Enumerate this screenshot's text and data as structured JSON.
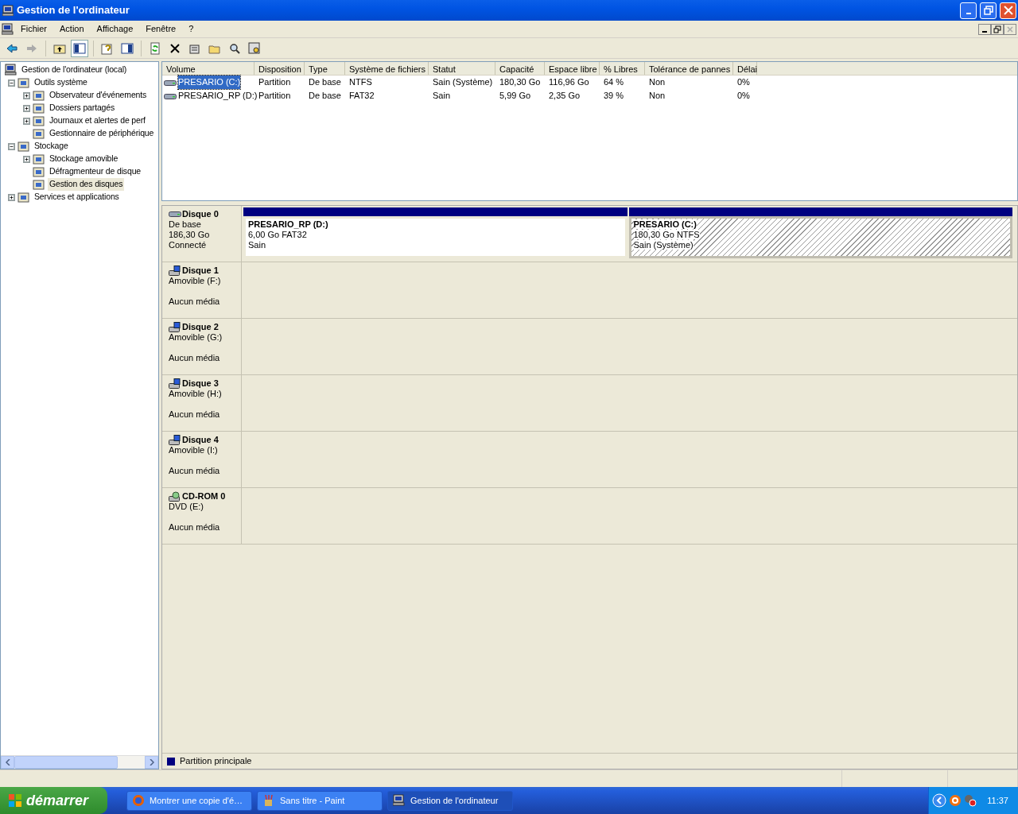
{
  "window": {
    "title": "Gestion de l'ordinateur"
  },
  "menu": [
    "Fichier",
    "Action",
    "Affichage",
    "Fenêtre",
    "?"
  ],
  "tree": [
    {
      "label": "Gestion de l'ordinateur (local)",
      "selected": false,
      "children": [
        {
          "label": "Outils système",
          "expanded": true,
          "selected": false,
          "children": [
            {
              "label": "Observateur d'événements",
              "expanded": false,
              "selected": false
            },
            {
              "label": "Dossiers partagés",
              "expanded": false,
              "selected": false
            },
            {
              "label": "Journaux et alertes de perf",
              "expanded": false,
              "selected": false
            },
            {
              "label": "Gestionnaire de périphérique",
              "selected": false
            }
          ]
        },
        {
          "label": "Stockage",
          "expanded": true,
          "selected": false,
          "children": [
            {
              "label": "Stockage amovible",
              "expanded": false,
              "selected": false
            },
            {
              "label": "Défragmenteur de disque",
              "selected": false
            },
            {
              "label": "Gestion des disques",
              "selected": true
            }
          ]
        },
        {
          "label": "Services et applications",
          "expanded": false,
          "selected": false
        }
      ]
    }
  ],
  "table": {
    "columns": [
      "Volume",
      "Disposition",
      "Type",
      "Système de fichiers",
      "Statut",
      "Capacité",
      "Espace libre",
      "% Libres",
      "Tolérance de pannes",
      "Délai"
    ],
    "rows": [
      {
        "selected": true,
        "cells": [
          "PRESARIO (C:)",
          "Partition",
          "De base",
          "NTFS",
          "Sain (Système)",
          "180,30 Go",
          "116,96 Go",
          "64 %",
          "Non",
          "0%"
        ]
      },
      {
        "selected": false,
        "cells": [
          "PRESARIO_RP (D:)",
          "Partition",
          "De base",
          "FAT32",
          "Sain",
          "5,99 Go",
          "2,35 Go",
          "39 %",
          "Non",
          "0%"
        ]
      }
    ]
  },
  "disks": [
    {
      "kind": "basic",
      "name": "Disque 0",
      "lines": [
        "De base",
        "186,30 Go",
        "Connecté"
      ],
      "partitions": [
        {
          "name": "PRESARIO_RP  (D:)",
          "lines": [
            "6,00 Go FAT32",
            "Sain"
          ],
          "selected": false
        },
        {
          "name": "PRESARIO  (C:)",
          "lines": [
            "180,30 Go NTFS",
            "Sain (Système)"
          ],
          "selected": true
        }
      ]
    },
    {
      "kind": "removable",
      "name": "Disque 1",
      "lines": [
        "Amovible (F:)",
        "Aucun média"
      ]
    },
    {
      "kind": "removable",
      "name": "Disque 2",
      "lines": [
        "Amovible (G:)",
        "Aucun média"
      ]
    },
    {
      "kind": "removable",
      "name": "Disque 3",
      "lines": [
        "Amovible (H:)",
        "Aucun média"
      ]
    },
    {
      "kind": "removable",
      "name": "Disque 4",
      "lines": [
        "Amovible (I:)",
        "Aucun média"
      ]
    },
    {
      "kind": "cdrom",
      "name": "CD-ROM 0",
      "lines": [
        "DVD (E:)",
        "Aucun média"
      ]
    }
  ],
  "legend": [
    {
      "label": "Partition principale",
      "color": "#000080"
    }
  ],
  "taskbar": {
    "start": "démarrer",
    "tasks": [
      {
        "kind": "browser",
        "label": "Montrer une copie d'é…",
        "selected": false
      },
      {
        "kind": "paint",
        "label": "Sans titre - Paint",
        "selected": false
      },
      {
        "kind": "computer",
        "label": "Gestion de l'ordinateur",
        "selected": true
      }
    ],
    "clock": "11:37"
  }
}
